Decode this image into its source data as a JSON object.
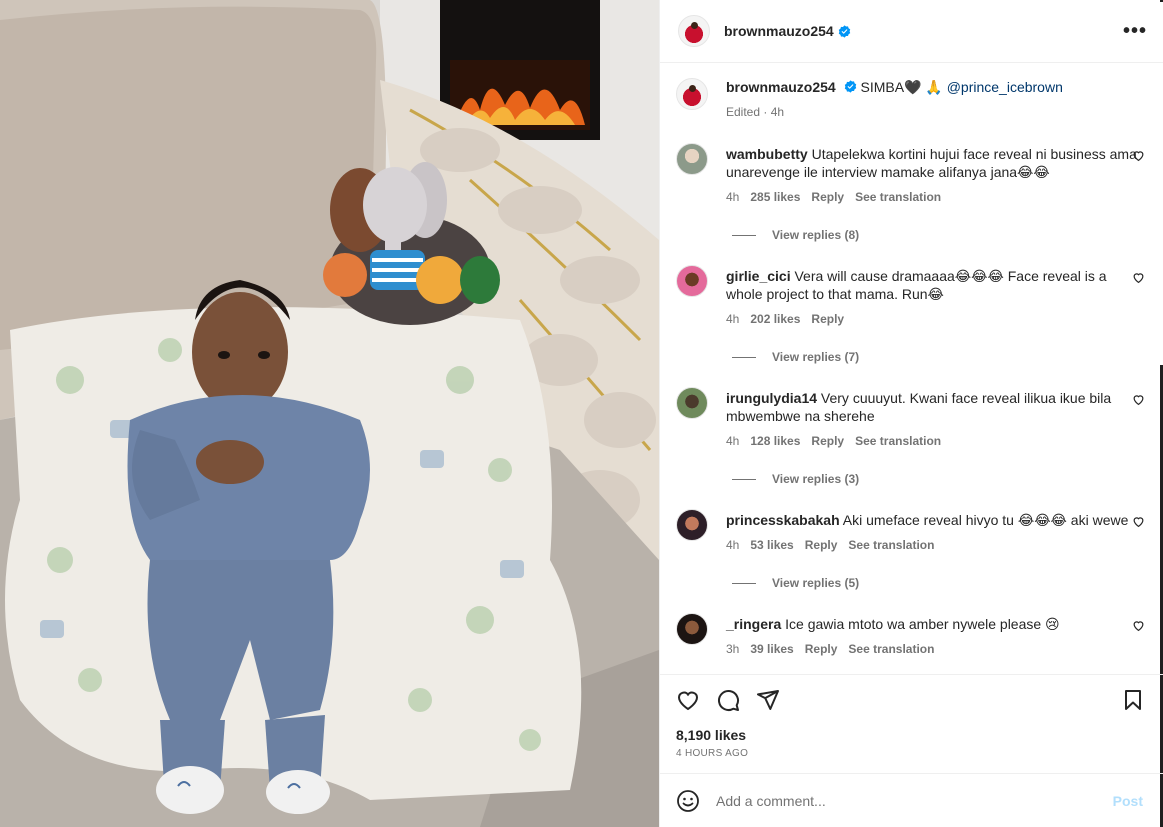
{
  "post": {
    "owner": "brownmauzo254",
    "caption_text": "SIMBA🖤 🙏",
    "caption_mention": "@prince_icebrown",
    "caption_meta": "Edited · 4h"
  },
  "comments": [
    {
      "username": "wambubetty",
      "text": "Utapelekwa kortini hujui face reveal ni business ama unarevenge ile interview mamake alifanya jana😂😂",
      "time": "4h",
      "likes": "285 likes",
      "reply": "Reply",
      "translate": "See translation",
      "view_replies": "View replies (8)"
    },
    {
      "username": "girlie_cici",
      "text": "Vera will cause dramaaaa😂😂😂 Face reveal is a whole project to that mama. Run😂",
      "time": "4h",
      "likes": "202 likes",
      "reply": "Reply",
      "translate": "",
      "view_replies": "View replies (7)"
    },
    {
      "username": "irungulydia14",
      "text": "Very cuuuyut. Kwani face reveal ilikua ikue bila mbwembwe na sherehe",
      "time": "4h",
      "likes": "128 likes",
      "reply": "Reply",
      "translate": "See translation",
      "view_replies": "View replies (3)"
    },
    {
      "username": "princesskabakah",
      "text": "Aki umeface reveal hivyo tu 😂😂😂 aki wewe",
      "time": "4h",
      "likes": "53 likes",
      "reply": "Reply",
      "translate": "See translation",
      "view_replies": "View replies (5)"
    },
    {
      "username": "_ringera",
      "text": "Ice gawia mtoto wa amber nywele please 😢",
      "time": "3h",
      "likes": "39 likes",
      "reply": "Reply",
      "translate": "See translation",
      "view_replies": ""
    }
  ],
  "actions": {
    "likes": "8,190 likes",
    "time": "4 HOURS AGO"
  },
  "add_comment": {
    "placeholder": "Add a comment...",
    "post_label": "Post"
  },
  "colors": {
    "verified": "#0095f6",
    "post_button": "#b2dffc",
    "mention": "#00376b"
  }
}
